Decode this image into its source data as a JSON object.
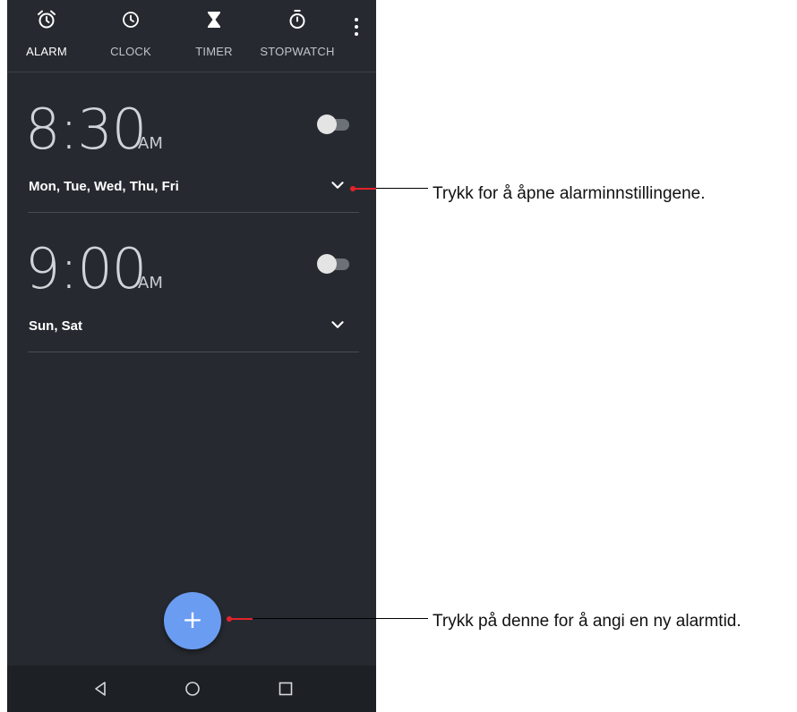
{
  "tabs": [
    {
      "label": "ALARM",
      "icon": "alarm-clock-icon",
      "active": true
    },
    {
      "label": "CLOCK",
      "icon": "clock-icon",
      "active": false
    },
    {
      "label": "TIMER",
      "icon": "hourglass-icon",
      "active": false
    },
    {
      "label": "STOPWATCH",
      "icon": "stopwatch-icon",
      "active": false
    }
  ],
  "alarms": [
    {
      "time": "8:30",
      "ampm": "AM",
      "days": "Mon, Tue, Wed, Thu, Fri",
      "enabled": false
    },
    {
      "time": "9:00",
      "ampm": "AM",
      "days": "Sun, Sat",
      "enabled": false
    }
  ],
  "fab": {
    "label": "+"
  },
  "callouts": {
    "expand": "Trykk for å åpne alarminnstillingene.",
    "add": "Trykk på denne for å angi en ny alarmtid."
  },
  "colors": {
    "background": "#262a30",
    "accent": "#6a9cf2",
    "callout_pointer": "#e3232a"
  }
}
